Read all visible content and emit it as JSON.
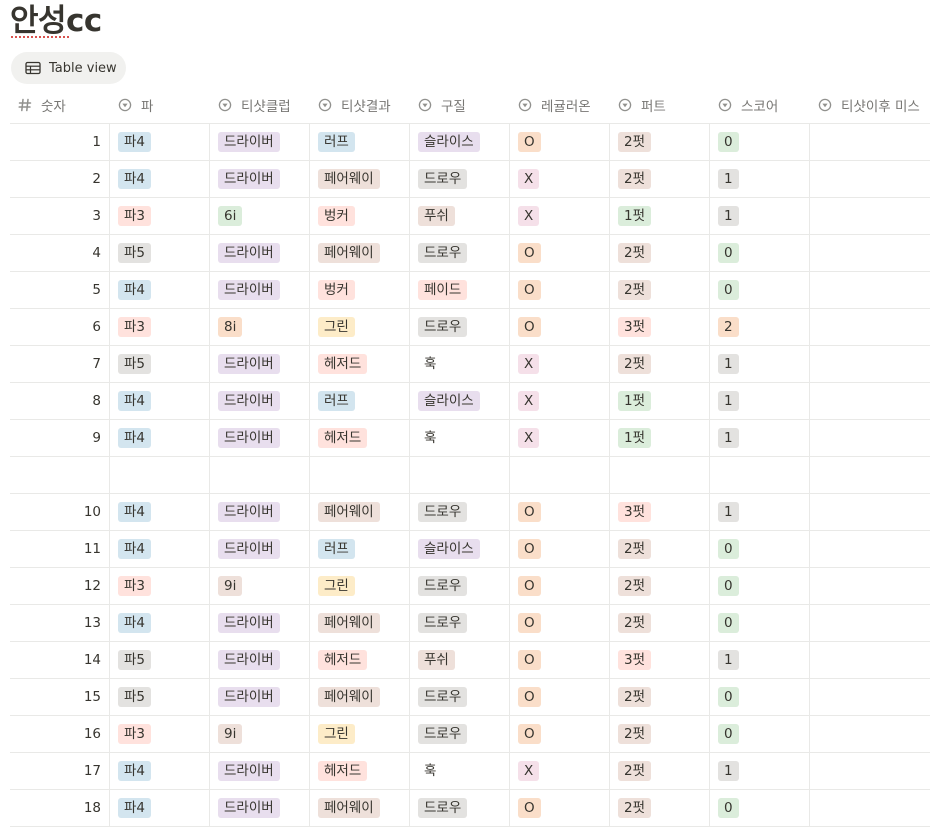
{
  "page_title": "안성cc",
  "view_button": {
    "label": "Table view",
    "icon": "table-icon"
  },
  "columns": [
    {
      "label": "숫자",
      "icon": "number-icon"
    },
    {
      "label": "파",
      "icon": "select-icon"
    },
    {
      "label": "티샷클럽",
      "icon": "select-icon"
    },
    {
      "label": "티샷결과",
      "icon": "select-icon"
    },
    {
      "label": "구질",
      "icon": "select-icon"
    },
    {
      "label": "레귤러온",
      "icon": "select-icon"
    },
    {
      "label": "퍼트",
      "icon": "select-icon"
    },
    {
      "label": "스코어",
      "icon": "select-icon"
    },
    {
      "label": "티샷이후 미스",
      "icon": "select-icon"
    }
  ],
  "tag_colors": {
    "blue": "#d3e5ef",
    "red": "#ffe2dd",
    "gray": "#e3e2e0",
    "purple": "#e8deee",
    "brown": "#eee0da",
    "green": "#dbeddb",
    "orange": "#fadec9",
    "yellow": "#fdecc8",
    "pink": "#f5e0e9"
  },
  "rows": [
    {
      "num": "1",
      "cells": [
        {
          "text": "파4",
          "color": "blue"
        },
        {
          "text": "드라이버",
          "color": "purple"
        },
        {
          "text": "러프",
          "color": "blue"
        },
        {
          "text": "슬라이스",
          "color": "purple"
        },
        {
          "text": "O",
          "color": "orange"
        },
        {
          "text": "2펏",
          "color": "brown"
        },
        {
          "text": "0",
          "color": "green"
        }
      ]
    },
    {
      "num": "2",
      "cells": [
        {
          "text": "파4",
          "color": "blue"
        },
        {
          "text": "드라이버",
          "color": "purple"
        },
        {
          "text": "페어웨이",
          "color": "brown"
        },
        {
          "text": "드로우",
          "color": "gray"
        },
        {
          "text": "X",
          "color": "pink"
        },
        {
          "text": "2펏",
          "color": "brown"
        },
        {
          "text": "1",
          "color": "gray"
        }
      ]
    },
    {
      "num": "3",
      "cells": [
        {
          "text": "파3",
          "color": "red"
        },
        {
          "text": "6i",
          "color": "green"
        },
        {
          "text": "벙커",
          "color": "red"
        },
        {
          "text": "푸쉬",
          "color": "brown"
        },
        {
          "text": "X",
          "color": "pink"
        },
        {
          "text": "1펏",
          "color": "green"
        },
        {
          "text": "1",
          "color": "gray"
        }
      ]
    },
    {
      "num": "4",
      "cells": [
        {
          "text": "파5",
          "color": "gray"
        },
        {
          "text": "드라이버",
          "color": "purple"
        },
        {
          "text": "페어웨이",
          "color": "brown"
        },
        {
          "text": "드로우",
          "color": "gray"
        },
        {
          "text": "O",
          "color": "orange"
        },
        {
          "text": "2펏",
          "color": "brown"
        },
        {
          "text": "0",
          "color": "green"
        }
      ]
    },
    {
      "num": "5",
      "cells": [
        {
          "text": "파4",
          "color": "blue"
        },
        {
          "text": "드라이버",
          "color": "purple"
        },
        {
          "text": "벙커",
          "color": "red"
        },
        {
          "text": "페이드",
          "color": "red"
        },
        {
          "text": "O",
          "color": "orange"
        },
        {
          "text": "2펏",
          "color": "brown"
        },
        {
          "text": "0",
          "color": "green"
        }
      ]
    },
    {
      "num": "6",
      "cells": [
        {
          "text": "파3",
          "color": "red"
        },
        {
          "text": "8i",
          "color": "orange"
        },
        {
          "text": "그린",
          "color": "yellow"
        },
        {
          "text": "드로우",
          "color": "gray"
        },
        {
          "text": "O",
          "color": "orange"
        },
        {
          "text": "3펏",
          "color": "red"
        },
        {
          "text": "2",
          "color": "orange"
        }
      ]
    },
    {
      "num": "7",
      "cells": [
        {
          "text": "파5",
          "color": "gray"
        },
        {
          "text": "드라이버",
          "color": "purple"
        },
        {
          "text": "헤저드",
          "color": "red"
        },
        {
          "text": "훅",
          "color": "none"
        },
        {
          "text": "X",
          "color": "pink"
        },
        {
          "text": "2펏",
          "color": "brown"
        },
        {
          "text": "1",
          "color": "gray"
        }
      ]
    },
    {
      "num": "8",
      "cells": [
        {
          "text": "파4",
          "color": "blue"
        },
        {
          "text": "드라이버",
          "color": "purple"
        },
        {
          "text": "러프",
          "color": "blue"
        },
        {
          "text": "슬라이스",
          "color": "purple"
        },
        {
          "text": "X",
          "color": "pink"
        },
        {
          "text": "1펏",
          "color": "green"
        },
        {
          "text": "1",
          "color": "gray"
        }
      ]
    },
    {
      "num": "9",
      "cells": [
        {
          "text": "파4",
          "color": "blue"
        },
        {
          "text": "드라이버",
          "color": "purple"
        },
        {
          "text": "헤저드",
          "color": "red"
        },
        {
          "text": "훅",
          "color": "none"
        },
        {
          "text": "X",
          "color": "pink"
        },
        {
          "text": "1펏",
          "color": "green"
        },
        {
          "text": "1",
          "color": "gray"
        }
      ]
    },
    {
      "num": "",
      "cells": []
    },
    {
      "num": "10",
      "cells": [
        {
          "text": "파4",
          "color": "blue"
        },
        {
          "text": "드라이버",
          "color": "purple"
        },
        {
          "text": "페어웨이",
          "color": "brown"
        },
        {
          "text": "드로우",
          "color": "gray"
        },
        {
          "text": "O",
          "color": "orange"
        },
        {
          "text": "3펏",
          "color": "red"
        },
        {
          "text": "1",
          "color": "gray"
        }
      ]
    },
    {
      "num": "11",
      "cells": [
        {
          "text": "파4",
          "color": "blue"
        },
        {
          "text": "드라이버",
          "color": "purple"
        },
        {
          "text": "러프",
          "color": "blue"
        },
        {
          "text": "슬라이스",
          "color": "purple"
        },
        {
          "text": "O",
          "color": "orange"
        },
        {
          "text": "2펏",
          "color": "brown"
        },
        {
          "text": "0",
          "color": "green"
        }
      ]
    },
    {
      "num": "12",
      "cells": [
        {
          "text": "파3",
          "color": "red"
        },
        {
          "text": "9i",
          "color": "brown"
        },
        {
          "text": "그린",
          "color": "yellow"
        },
        {
          "text": "드로우",
          "color": "gray"
        },
        {
          "text": "O",
          "color": "orange"
        },
        {
          "text": "2펏",
          "color": "brown"
        },
        {
          "text": "0",
          "color": "green"
        }
      ]
    },
    {
      "num": "13",
      "cells": [
        {
          "text": "파4",
          "color": "blue"
        },
        {
          "text": "드라이버",
          "color": "purple"
        },
        {
          "text": "페어웨이",
          "color": "brown"
        },
        {
          "text": "드로우",
          "color": "gray"
        },
        {
          "text": "O",
          "color": "orange"
        },
        {
          "text": "2펏",
          "color": "brown"
        },
        {
          "text": "0",
          "color": "green"
        }
      ]
    },
    {
      "num": "14",
      "cells": [
        {
          "text": "파5",
          "color": "gray"
        },
        {
          "text": "드라이버",
          "color": "purple"
        },
        {
          "text": "헤저드",
          "color": "red"
        },
        {
          "text": "푸쉬",
          "color": "brown"
        },
        {
          "text": "O",
          "color": "orange"
        },
        {
          "text": "3펏",
          "color": "red"
        },
        {
          "text": "1",
          "color": "gray"
        }
      ]
    },
    {
      "num": "15",
      "cells": [
        {
          "text": "파5",
          "color": "gray"
        },
        {
          "text": "드라이버",
          "color": "purple"
        },
        {
          "text": "페어웨이",
          "color": "brown"
        },
        {
          "text": "드로우",
          "color": "gray"
        },
        {
          "text": "O",
          "color": "orange"
        },
        {
          "text": "2펏",
          "color": "brown"
        },
        {
          "text": "0",
          "color": "green"
        }
      ]
    },
    {
      "num": "16",
      "cells": [
        {
          "text": "파3",
          "color": "red"
        },
        {
          "text": "9i",
          "color": "brown"
        },
        {
          "text": "그린",
          "color": "yellow"
        },
        {
          "text": "드로우",
          "color": "gray"
        },
        {
          "text": "O",
          "color": "orange"
        },
        {
          "text": "2펏",
          "color": "brown"
        },
        {
          "text": "0",
          "color": "green"
        }
      ]
    },
    {
      "num": "17",
      "cells": [
        {
          "text": "파4",
          "color": "blue"
        },
        {
          "text": "드라이버",
          "color": "purple"
        },
        {
          "text": "헤저드",
          "color": "red"
        },
        {
          "text": "훅",
          "color": "none"
        },
        {
          "text": "X",
          "color": "pink"
        },
        {
          "text": "2펏",
          "color": "brown"
        },
        {
          "text": "1",
          "color": "gray"
        }
      ]
    },
    {
      "num": "18",
      "cells": [
        {
          "text": "파4",
          "color": "blue"
        },
        {
          "text": "드라이버",
          "color": "purple"
        },
        {
          "text": "페어웨이",
          "color": "brown"
        },
        {
          "text": "드로우",
          "color": "gray"
        },
        {
          "text": "O",
          "color": "orange"
        },
        {
          "text": "2펏",
          "color": "brown"
        },
        {
          "text": "0",
          "color": "green"
        }
      ]
    }
  ]
}
